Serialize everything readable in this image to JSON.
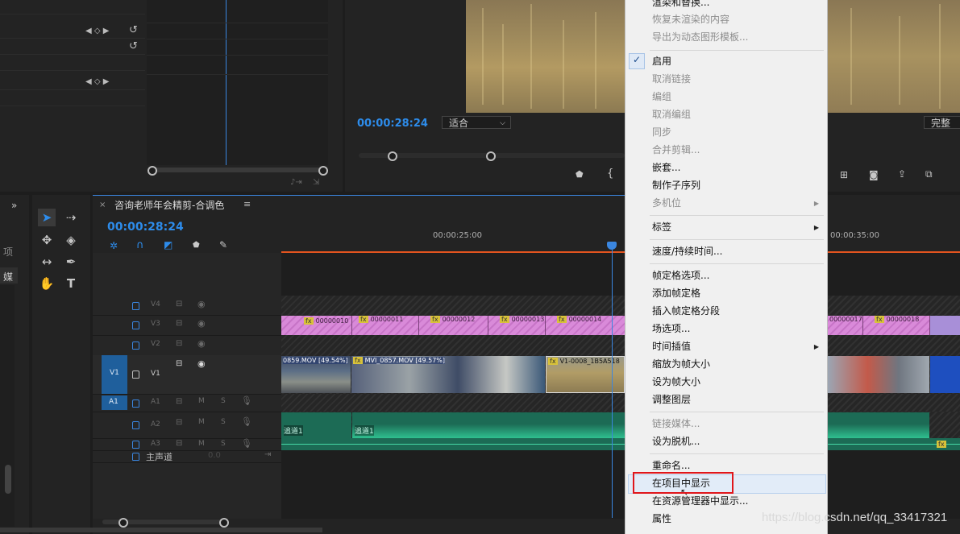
{
  "program_monitor": {
    "timecode": "00:00:28:24",
    "fit_label": "适合",
    "quality_label": "完整"
  },
  "timeline": {
    "sequence_title": "咨询老师年会精剪-合调色",
    "timecode": "00:00:28:24",
    "ruler_marks": [
      "00:00:25:00",
      "00:00:35:00"
    ],
    "tracks": {
      "video": [
        "V4",
        "V3",
        "V2",
        "V1"
      ],
      "audio": [
        "A1",
        "A2",
        "A3"
      ],
      "source_v1": "V1",
      "source_a1": "A1",
      "master_label": "主声道",
      "master_value": "0.0",
      "mute_label": "M",
      "solo_label": "S"
    },
    "v3_clips": [
      "00000010",
      "00000011",
      "00000012",
      "00000013",
      "00000014",
      "00000017",
      "00000018"
    ],
    "v1_clips": [
      "0859.MOV [49.54%]",
      "MVI_0857.MOV [49.57%]",
      "V1-0008_1B5A518"
    ],
    "audio_clip_labels": [
      "追道1",
      "追道1"
    ]
  },
  "left_panel": {
    "label_items": "项",
    "label_media": "媒"
  },
  "context_menu": {
    "items": [
      {
        "label": "渲染和替换...",
        "enabled": true
      },
      {
        "label": "恢复未渲染的内容",
        "enabled": false
      },
      {
        "label": "导出为动态图形模板...",
        "enabled": false
      },
      {
        "label": "启用",
        "enabled": true,
        "checked": true
      },
      {
        "label": "取消链接",
        "enabled": false
      },
      {
        "label": "编组",
        "enabled": false
      },
      {
        "label": "取消编组",
        "enabled": false
      },
      {
        "label": "同步",
        "enabled": false
      },
      {
        "label": "合并剪辑...",
        "enabled": false
      },
      {
        "label": "嵌套...",
        "enabled": true
      },
      {
        "label": "制作子序列",
        "enabled": true
      },
      {
        "label": "多机位",
        "enabled": false,
        "submenu": true
      },
      {
        "label": "标签",
        "enabled": true,
        "submenu": true
      },
      {
        "label": "速度/持续时间...",
        "enabled": true
      },
      {
        "label": "帧定格选项...",
        "enabled": true
      },
      {
        "label": "添加帧定格",
        "enabled": true
      },
      {
        "label": "插入帧定格分段",
        "enabled": true
      },
      {
        "label": "场选项...",
        "enabled": true
      },
      {
        "label": "时间插值",
        "enabled": true,
        "submenu": true
      },
      {
        "label": "缩放为帧大小",
        "enabled": true
      },
      {
        "label": "设为帧大小",
        "enabled": true
      },
      {
        "label": "调整图层",
        "enabled": true
      },
      {
        "label": "链接媒体...",
        "enabled": false
      },
      {
        "label": "设为脱机...",
        "enabled": true
      },
      {
        "label": "重命名...",
        "enabled": true
      },
      {
        "label": "在项目中显示",
        "enabled": true,
        "highlighted": true
      },
      {
        "label": "在资源管理器中显示...",
        "enabled": true
      },
      {
        "label": "属性",
        "enabled": true
      }
    ],
    "check_glyph": "✓",
    "submenu_glyph": "▶"
  },
  "watermark": "https://blog.csdn.net/qq_33417321",
  "colors": {
    "accent_blue": "#2d8ceb",
    "playhead_blue": "#3a86e0",
    "highlight_red": "#e0161b",
    "clip_pink": "#d98ad9",
    "audio_green": "#1c6b55"
  }
}
